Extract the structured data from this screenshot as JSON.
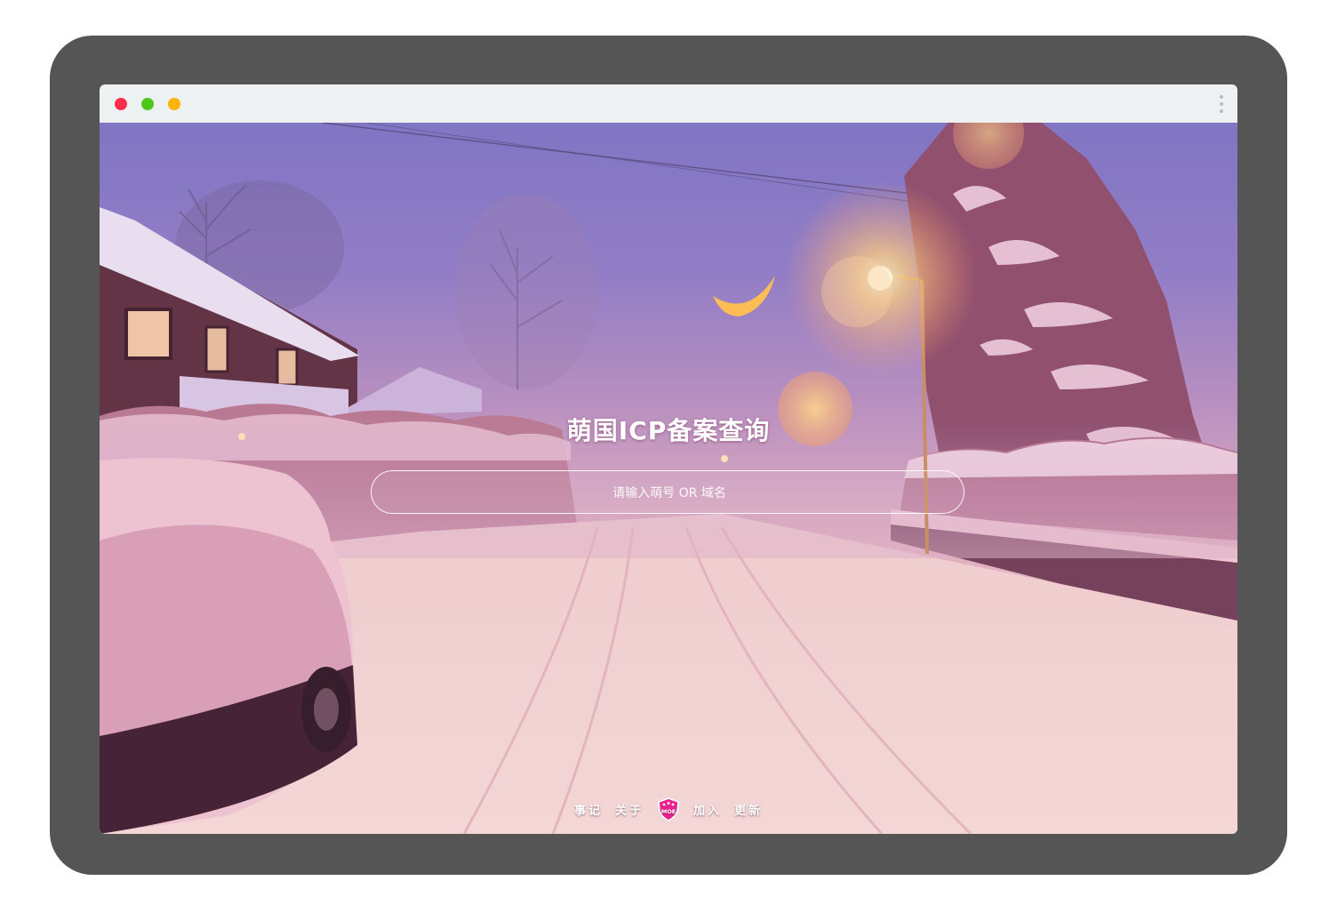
{
  "browser": {
    "traffic_lights": [
      "#fc2d4a",
      "#4fc61c",
      "#fcb30e"
    ],
    "menu_icon": "kebab-vertical-icon"
  },
  "main": {
    "title": "萌国ICP备案查询",
    "search": {
      "placeholder": "请输入萌号 OR 域名",
      "value": ""
    }
  },
  "footer": {
    "links": [
      "事记",
      "关于",
      "加入",
      "更新"
    ],
    "badge": {
      "icon": "moe-shield-badge-icon",
      "text": "MOE",
      "color": "#e8238c"
    }
  }
}
